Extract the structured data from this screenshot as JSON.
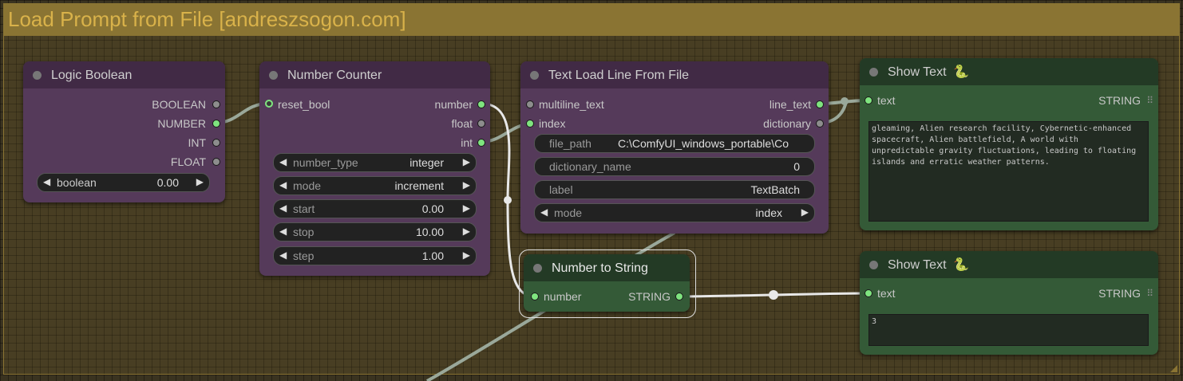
{
  "group": {
    "title": "Load Prompt from File [andreszsogon.com]"
  },
  "colors": {
    "purple_body": "#553a5a",
    "purple_head": "#412a45",
    "green_body": "#345a37",
    "green_head": "#233a25",
    "group_color": "#8a7433",
    "slot_on": "#7fe47f"
  },
  "nodes": {
    "logic_boolean": {
      "title": "Logic Boolean",
      "outputs": [
        "BOOLEAN",
        "NUMBER",
        "INT",
        "FLOAT"
      ],
      "widget": {
        "label": "boolean",
        "value": "0.00"
      }
    },
    "number_counter": {
      "title": "Number Counter",
      "input": "reset_bool",
      "outputs": [
        "number",
        "float",
        "int"
      ],
      "widgets": [
        {
          "label": "number_type",
          "value": "integer"
        },
        {
          "label": "mode",
          "value": "increment"
        },
        {
          "label": "start",
          "value": "0.00"
        },
        {
          "label": "stop",
          "value": "10.00"
        },
        {
          "label": "step",
          "value": "1.00"
        }
      ]
    },
    "text_load_line": {
      "title": "Text Load Line From File",
      "inputs": [
        "multiline_text",
        "index"
      ],
      "outputs": [
        "line_text",
        "dictionary"
      ],
      "widgets": [
        {
          "label": "file_path",
          "value": "C:\\ComfyUI_windows_portable\\Co"
        },
        {
          "label": "dictionary_name",
          "value": "0"
        },
        {
          "label": "label",
          "value": "TextBatch"
        },
        {
          "label": "mode",
          "value": "index"
        }
      ]
    },
    "number_to_string": {
      "title": "Number to String",
      "input": "number",
      "output": "STRING"
    },
    "show_text_1": {
      "title": "Show Text",
      "icon": "snake-icon",
      "input": "text",
      "output": "STRING",
      "content": "gleaming, Alien research facility, Cybernetic-enhanced spacecraft, Alien battlefield, A world with unpredictable gravity fluctuations, leading to floating islands and erratic weather patterns."
    },
    "show_text_2": {
      "title": "Show Text",
      "icon": "snake-icon",
      "input": "text",
      "output": "STRING",
      "content": "3"
    }
  },
  "glyphs": {
    "left_arrow": "◀",
    "right_arrow": "▶",
    "snake": "🐍",
    "grid": "⠿"
  }
}
